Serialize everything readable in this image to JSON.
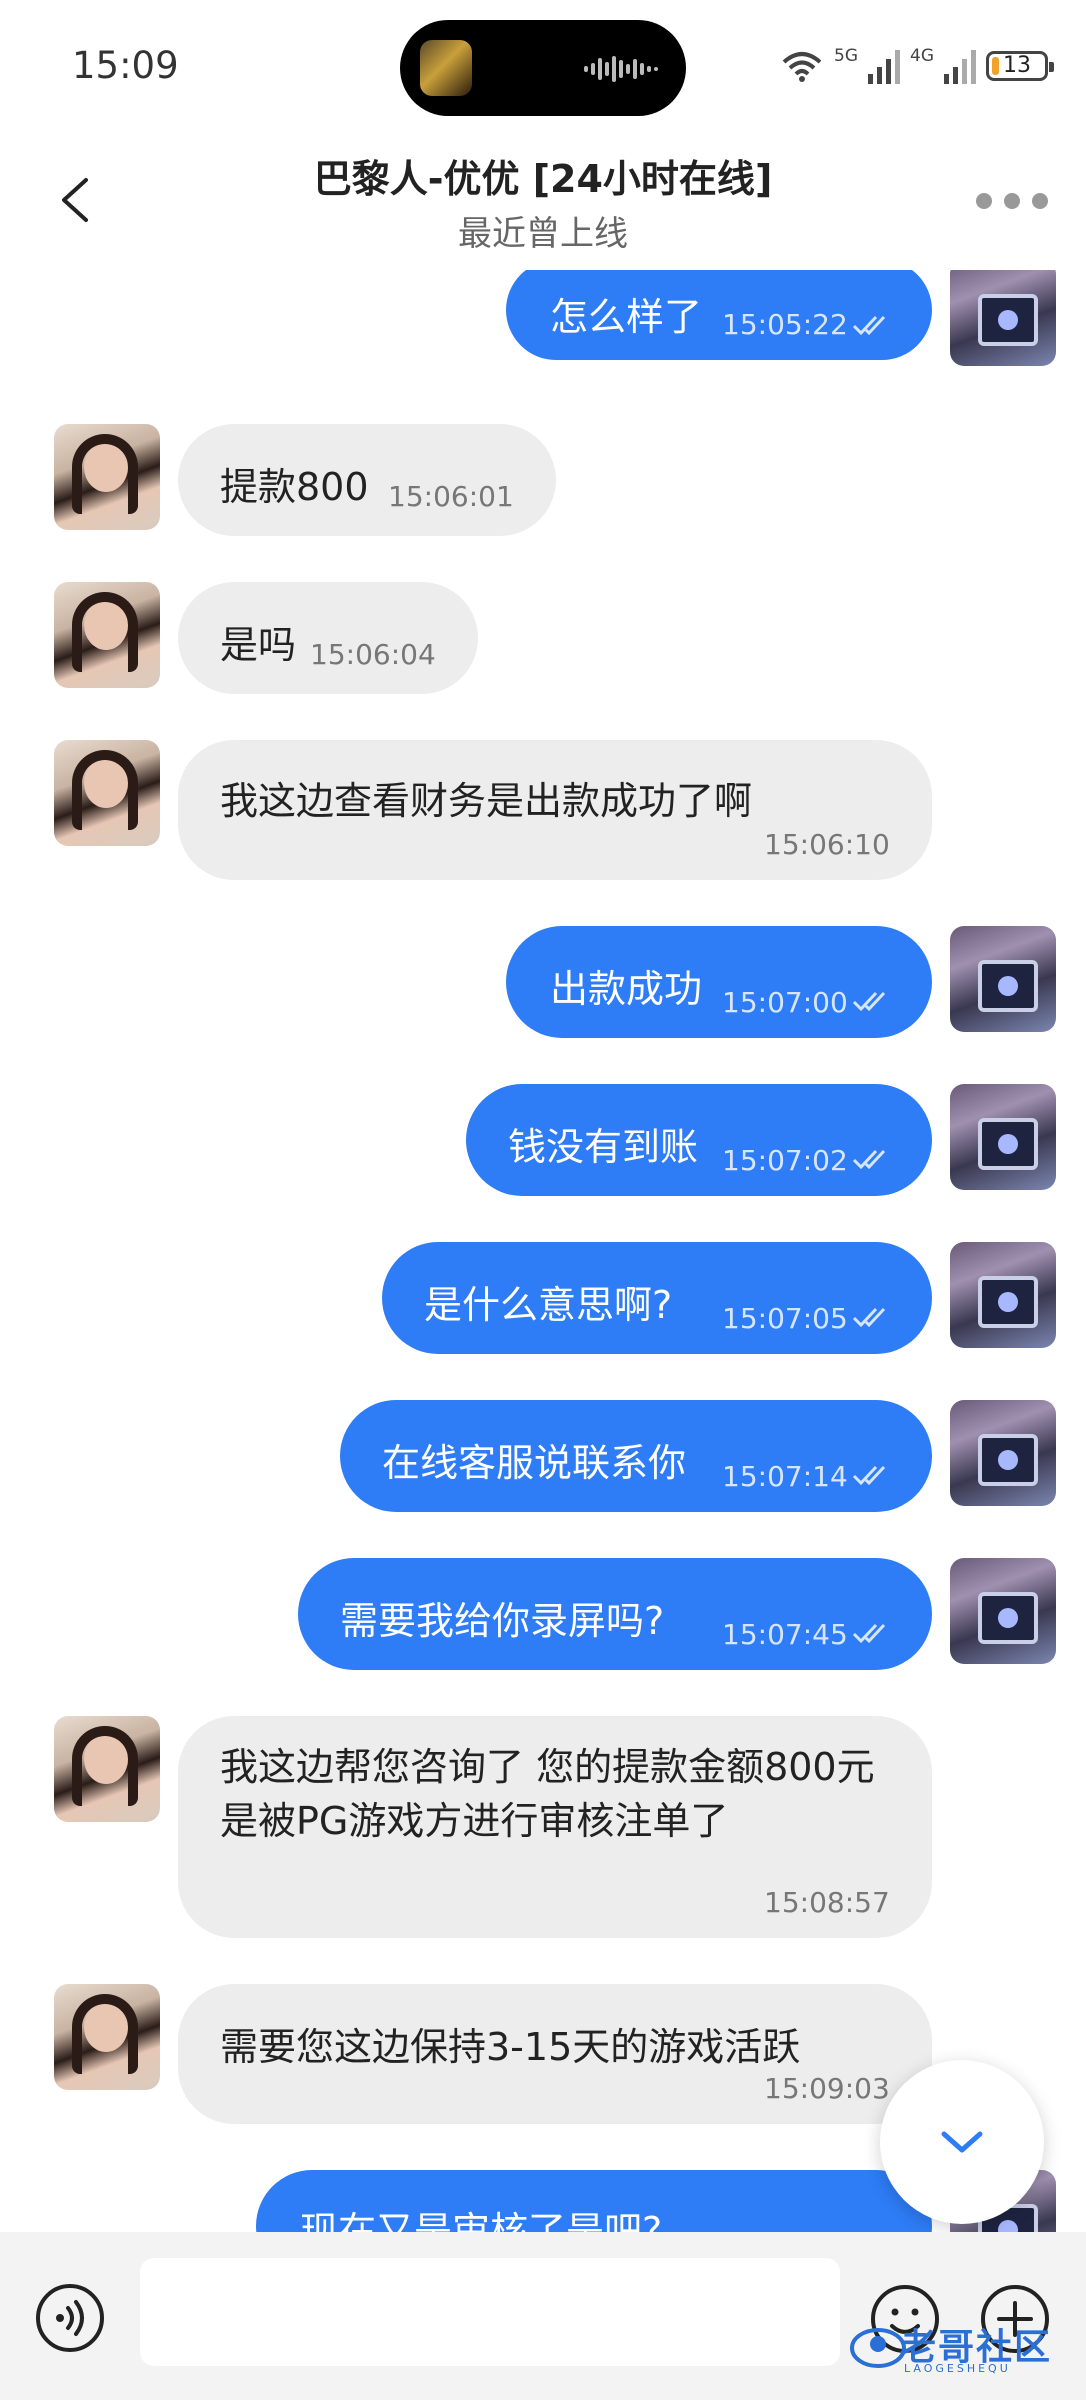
{
  "status_bar": {
    "time": "15:09",
    "signal_1_label": "5G",
    "signal_2_label": "4G",
    "battery_level": "13",
    "battery_fraction": 0.13
  },
  "header": {
    "title": "巴黎人-优优 [24小时在线]",
    "subtitle": "最近曾上线"
  },
  "messages": [
    {
      "side": "out",
      "text": "怎么样了",
      "time": "15:05:22"
    },
    {
      "side": "in",
      "text": "提款800",
      "time": "15:06:01"
    },
    {
      "side": "in",
      "text": "是吗",
      "time": "15:06:04"
    },
    {
      "side": "in",
      "text": "我这边查看财务是出款成功了啊",
      "time": "15:06:10"
    },
    {
      "side": "out",
      "text": "出款成功",
      "time": "15:07:00"
    },
    {
      "side": "out",
      "text": "钱没有到账",
      "time": "15:07:02"
    },
    {
      "side": "out",
      "text": "是什么意思啊?",
      "time": "15:07:05"
    },
    {
      "side": "out",
      "text": "在线客服说联系你",
      "time": "15:07:14"
    },
    {
      "side": "out",
      "text": "需要我给你录屏吗?",
      "time": "15:07:45"
    },
    {
      "side": "in",
      "text": "我这边帮您咨询了 您的提款金额800元是被PG游戏方进行审核注单了",
      "time": "15:08:57"
    },
    {
      "side": "in",
      "text": "需要您这边保持3-15天的游戏活跃",
      "time": "15:09:03"
    },
    {
      "side": "out",
      "text": "现在又是审核了是吧?",
      "time": ""
    }
  ],
  "input": {
    "placeholder": ""
  },
  "watermark": {
    "text": "老哥社区",
    "sub": "LAOGESHEQU"
  },
  "colors": {
    "outgoing_bubble": "#2e7cf6",
    "incoming_bubble": "#ededed",
    "battery_low": "#f2a22a"
  }
}
